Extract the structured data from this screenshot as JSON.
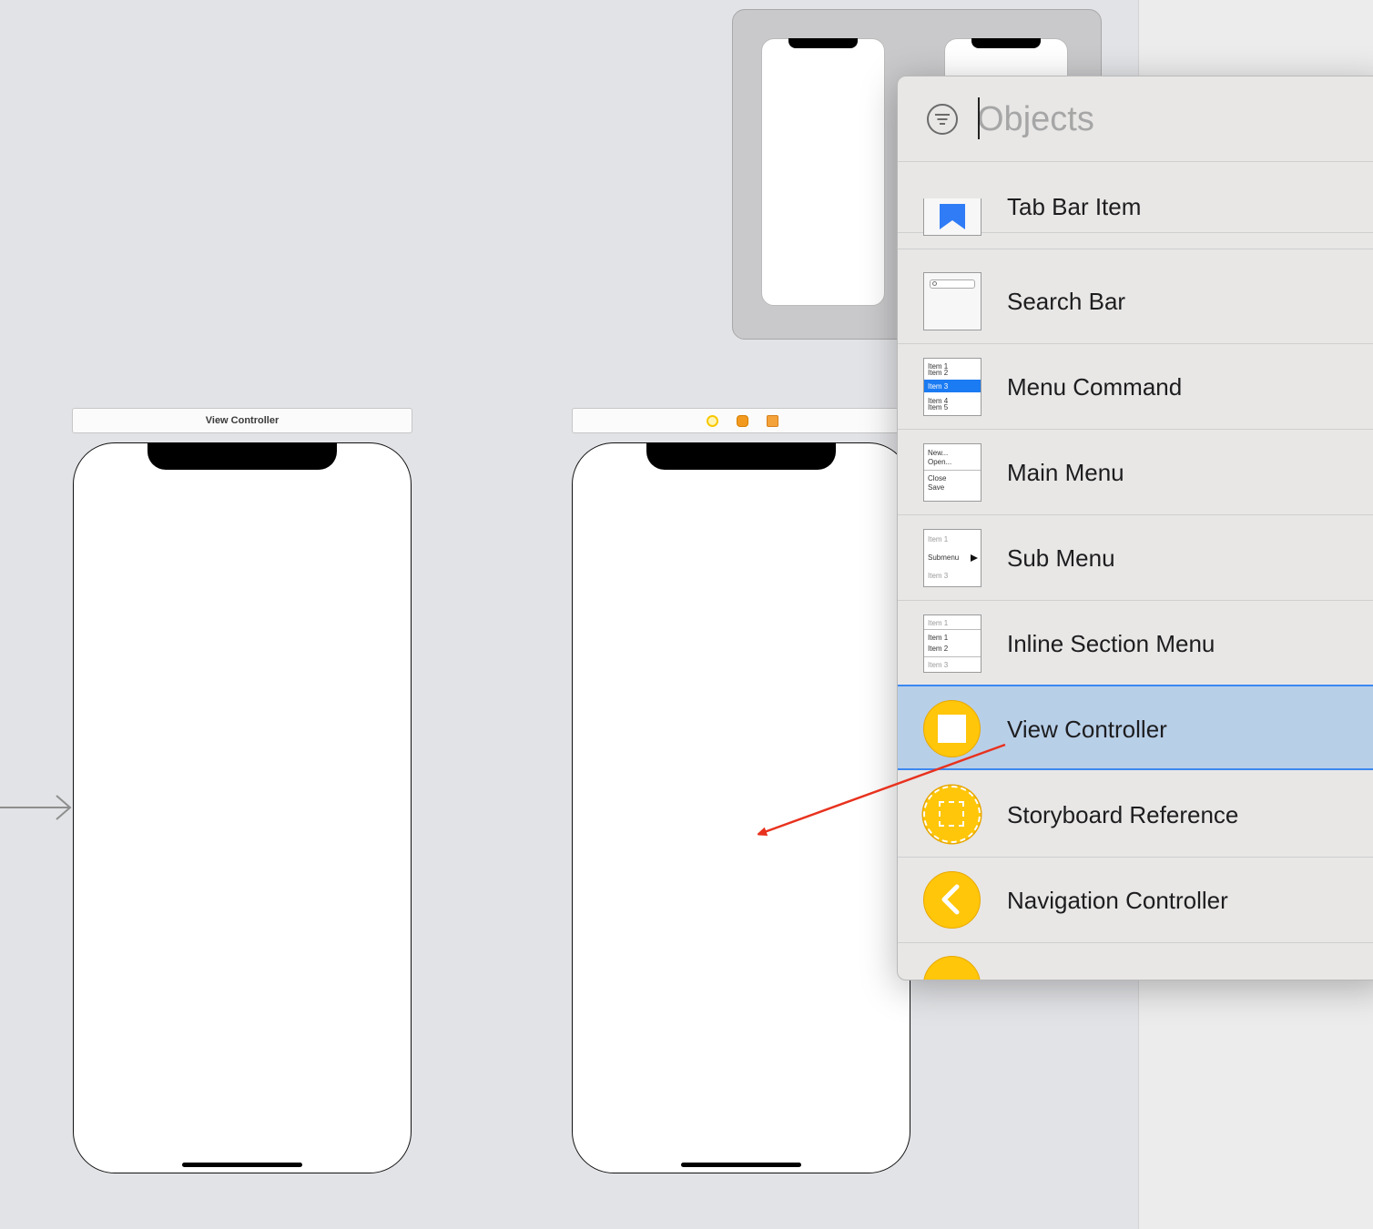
{
  "canvas": {
    "scene_left_title": "View Controller",
    "entry_point": "storyboard-entry-arrow"
  },
  "library": {
    "search_placeholder": "Objects",
    "search_value": "",
    "items": [
      {
        "label": "Tab Bar Item",
        "icon": "tab-bar-item-icon"
      },
      {
        "label": "Search Bar",
        "icon": "search-bar-icon"
      },
      {
        "label": "Menu Command",
        "icon": "menu-command-icon"
      },
      {
        "label": "Main Menu",
        "icon": "main-menu-icon"
      },
      {
        "label": "Sub Menu",
        "icon": "sub-menu-icon"
      },
      {
        "label": "Inline Section Menu",
        "icon": "inline-section-menu-icon"
      },
      {
        "label": "View Controller",
        "icon": "view-controller-icon",
        "selected": true
      },
      {
        "label": "Storyboard Reference",
        "icon": "storyboard-reference-icon"
      },
      {
        "label": "Navigation Controller",
        "icon": "navigation-controller-icon"
      }
    ],
    "thumb_text": {
      "menu_command": [
        "Item 1",
        "Item 2",
        "Item 3",
        "Item 4",
        "Item 5"
      ],
      "main_menu": [
        "New...",
        "Open...",
        "Close",
        "Save"
      ],
      "sub_menu": [
        "Item 1",
        "Submenu",
        "Item 3"
      ],
      "inline_section": [
        "Item 1",
        "Item 1",
        "Item 2",
        "Item 3"
      ]
    }
  },
  "colors": {
    "selection": "#b8cfe8",
    "accent": "#3c87f0",
    "object_yellow": "#ffc60a",
    "drag_arrow": "#e8321e"
  }
}
